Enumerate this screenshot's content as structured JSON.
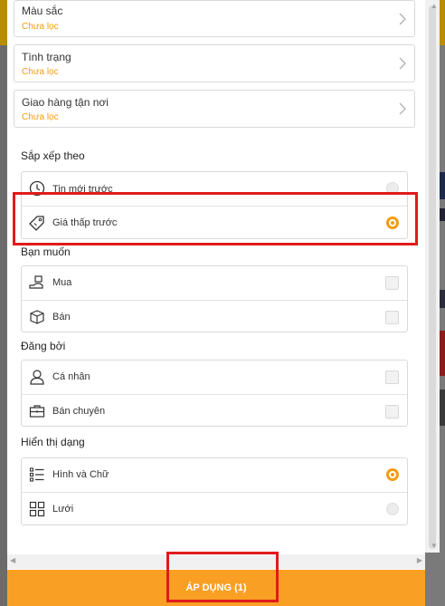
{
  "filters": [
    {
      "title": "Màu sắc",
      "value": "Chưa lọc"
    },
    {
      "title": "Tình trạng",
      "value": "Chưa lọc"
    },
    {
      "title": "Giao hàng tận nơi",
      "value": "Chưa lọc"
    }
  ],
  "sort": {
    "title": "Sắp xếp theo",
    "options": [
      {
        "label": "Tin mới trước",
        "icon": "clock-icon",
        "selected": false
      },
      {
        "label": "Giá thấp trước",
        "icon": "price-tag-icon",
        "selected": true
      }
    ]
  },
  "want": {
    "title": "Bạn muốn",
    "options": [
      {
        "label": "Mua",
        "icon": "hand-box-icon",
        "checked": false
      },
      {
        "label": "Bán",
        "icon": "box-icon",
        "checked": false
      }
    ]
  },
  "posted_by": {
    "title": "Đăng bởi",
    "options": [
      {
        "label": "Cá nhân",
        "icon": "person-icon",
        "checked": false
      },
      {
        "label": "Bán chuyên",
        "icon": "briefcase-icon",
        "checked": false
      }
    ]
  },
  "display": {
    "title": "Hiển thị dạng",
    "options": [
      {
        "label": "Hình và Chữ",
        "icon": "list-icon",
        "selected": true
      },
      {
        "label": "Lưới",
        "icon": "grid-icon",
        "selected": false
      }
    ]
  },
  "apply_button": "ÁP DỤNG (1)",
  "colors": {
    "accent": "#f39c12",
    "apply_bg": "#f9a024",
    "highlight": "#e01b1b"
  }
}
